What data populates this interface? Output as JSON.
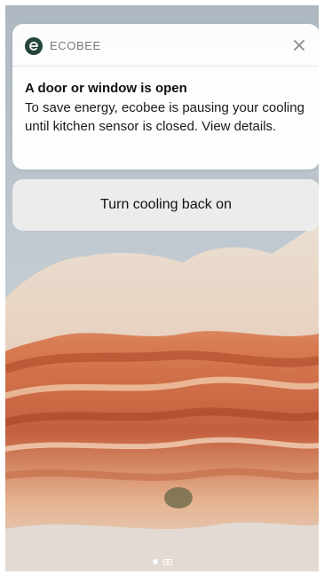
{
  "notification": {
    "app_name": "ECOBEE",
    "title": "A door or window is open",
    "body": "To save energy, ecobee is pausing your cooling until kitchen sensor is closed. View details."
  },
  "action": {
    "label": "Turn cooling back on"
  },
  "colors": {
    "app_icon": "#24453a",
    "card_bg": "#ffffff",
    "action_bg": "#eeeeee"
  },
  "icons": {
    "app": "ecobee-logo-icon",
    "close": "close-icon",
    "camera": "camera-icon"
  }
}
